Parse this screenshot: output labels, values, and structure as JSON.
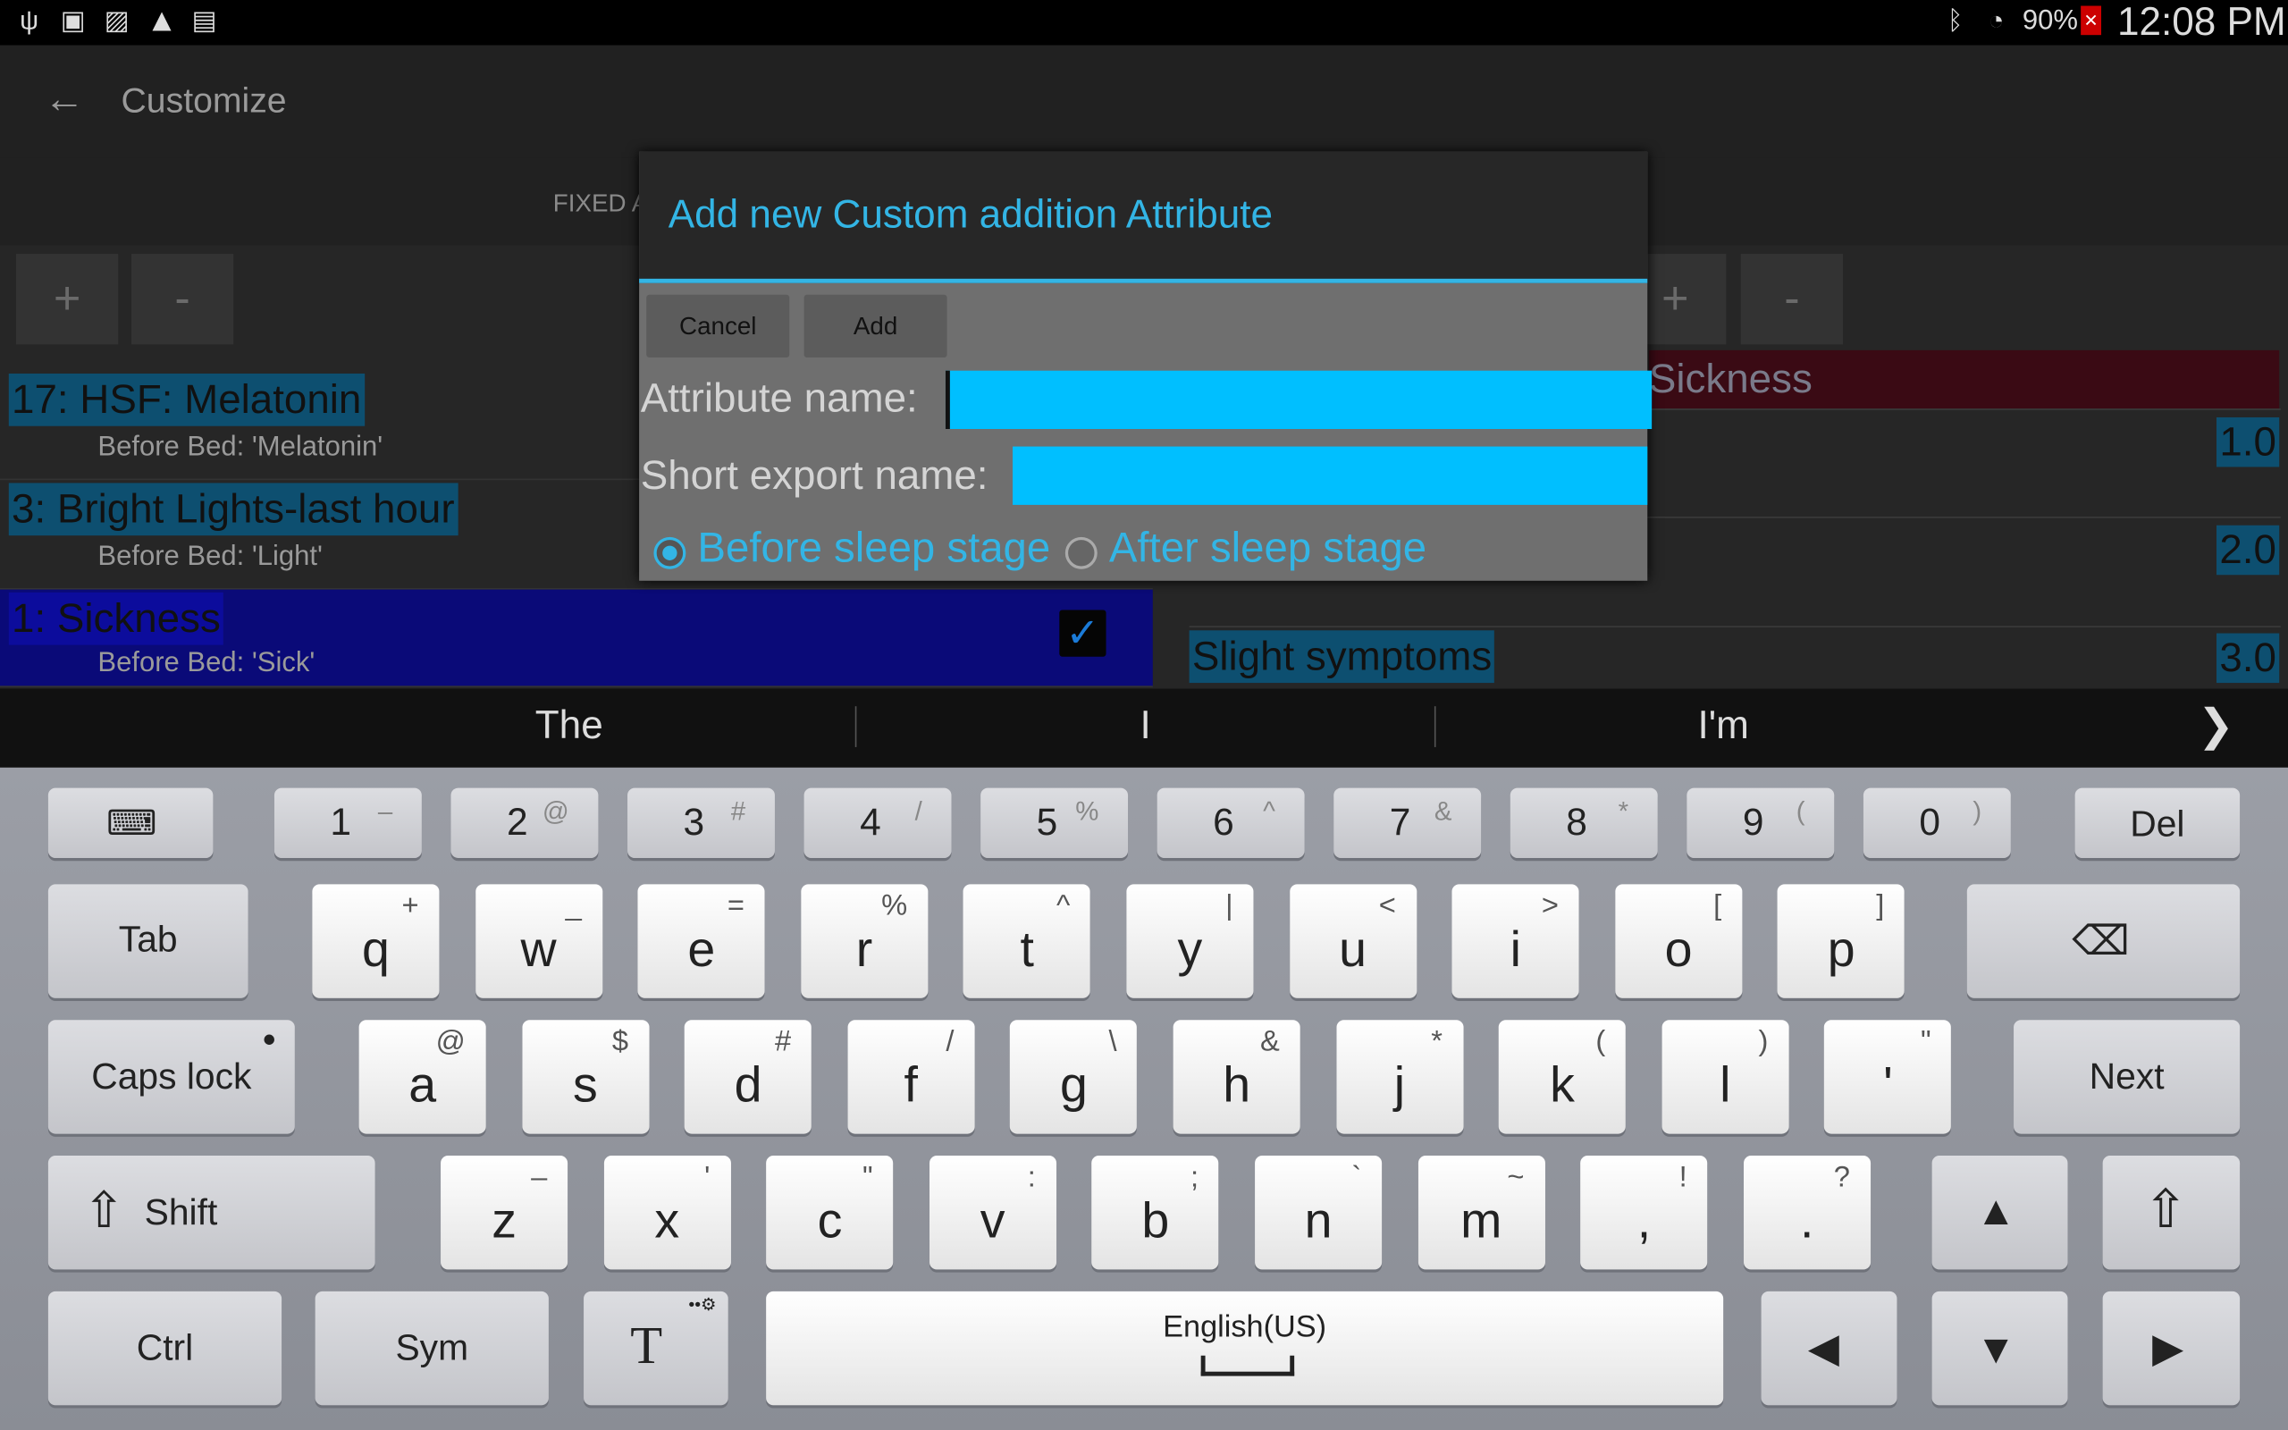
{
  "status": {
    "battery": "90%",
    "time": "12:08 PM",
    "left_icons": [
      "usb-icon",
      "sim-icon",
      "image-icon",
      "warning-icon",
      "clipboard-icon"
    ],
    "right_icons": [
      "bluetooth-icon",
      "wifi-icon",
      "battery-icon"
    ]
  },
  "appbar": {
    "title": "Customize",
    "tab_fixed": "FIXED A"
  },
  "toolbar": {
    "plus": "+",
    "minus": "-"
  },
  "list": {
    "items": [
      {
        "title": "17: HSF: Melatonin",
        "subtitle": "Before Bed: 'Melatonin'"
      },
      {
        "title": "3: Bright Lights-last hour",
        "subtitle": "Before Bed: 'Light'"
      },
      {
        "title": "1: Sickness",
        "subtitle": "Before Bed: 'Sick'",
        "checked": true
      }
    ]
  },
  "right_panel": {
    "header": "Sickness",
    "values": [
      "1.0",
      "2.0",
      "3.0"
    ],
    "slight": "Slight symptoms"
  },
  "dialog": {
    "title": "Add new Custom addition Attribute",
    "cancel": "Cancel",
    "add": "Add",
    "attr_label": "Attribute name:",
    "attr_value": "",
    "short_label": "Short export name:",
    "short_value": "",
    "radio_before": "Before sleep stage",
    "radio_after": "After sleep stage",
    "selected": "before",
    "accent": "#33b5e5",
    "input_color": "#00bfff"
  },
  "suggestions": [
    "The",
    "I",
    "I'm"
  ],
  "keyboard": {
    "numrow": [
      {
        "m": "1",
        "s": "–"
      },
      {
        "m": "2",
        "s": "@"
      },
      {
        "m": "3",
        "s": "#"
      },
      {
        "m": "4",
        "s": "/"
      },
      {
        "m": "5",
        "s": "%"
      },
      {
        "m": "6",
        "s": "^"
      },
      {
        "m": "7",
        "s": "&"
      },
      {
        "m": "8",
        "s": "*"
      },
      {
        "m": "9",
        "s": "("
      },
      {
        "m": "0",
        "s": ")"
      }
    ],
    "del": "Del",
    "tab": "Tab",
    "row1": [
      {
        "m": "q",
        "s": "+"
      },
      {
        "m": "w",
        "s": "_"
      },
      {
        "m": "e",
        "s": "="
      },
      {
        "m": "r",
        "s": "%"
      },
      {
        "m": "t",
        "s": "^"
      },
      {
        "m": "y",
        "s": "|"
      },
      {
        "m": "u",
        "s": "<"
      },
      {
        "m": "i",
        "s": ">"
      },
      {
        "m": "o",
        "s": "["
      },
      {
        "m": "p",
        "s": "]"
      }
    ],
    "caps": "Caps lock",
    "row2": [
      {
        "m": "a",
        "s": "@"
      },
      {
        "m": "s",
        "s": "$"
      },
      {
        "m": "d",
        "s": "#"
      },
      {
        "m": "f",
        "s": "/"
      },
      {
        "m": "g",
        "s": "\\"
      },
      {
        "m": "h",
        "s": "&"
      },
      {
        "m": "j",
        "s": "*"
      },
      {
        "m": "k",
        "s": "("
      },
      {
        "m": "l",
        "s": ")"
      },
      {
        "m": "'",
        "s": "\""
      }
    ],
    "next": "Next",
    "shift": "Shift",
    "row3": [
      {
        "m": "z",
        "s": "–"
      },
      {
        "m": "x",
        "s": "'"
      },
      {
        "m": "c",
        "s": "\""
      },
      {
        "m": "v",
        "s": ":"
      },
      {
        "m": "b",
        "s": ";"
      },
      {
        "m": "n",
        "s": "`"
      },
      {
        "m": "m",
        "s": "~"
      },
      {
        "m": ",",
        "s": "!"
      },
      {
        "m": ".",
        "s": "?"
      }
    ],
    "ctrl": "Ctrl",
    "sym": "Sym",
    "space": "English(US)"
  }
}
